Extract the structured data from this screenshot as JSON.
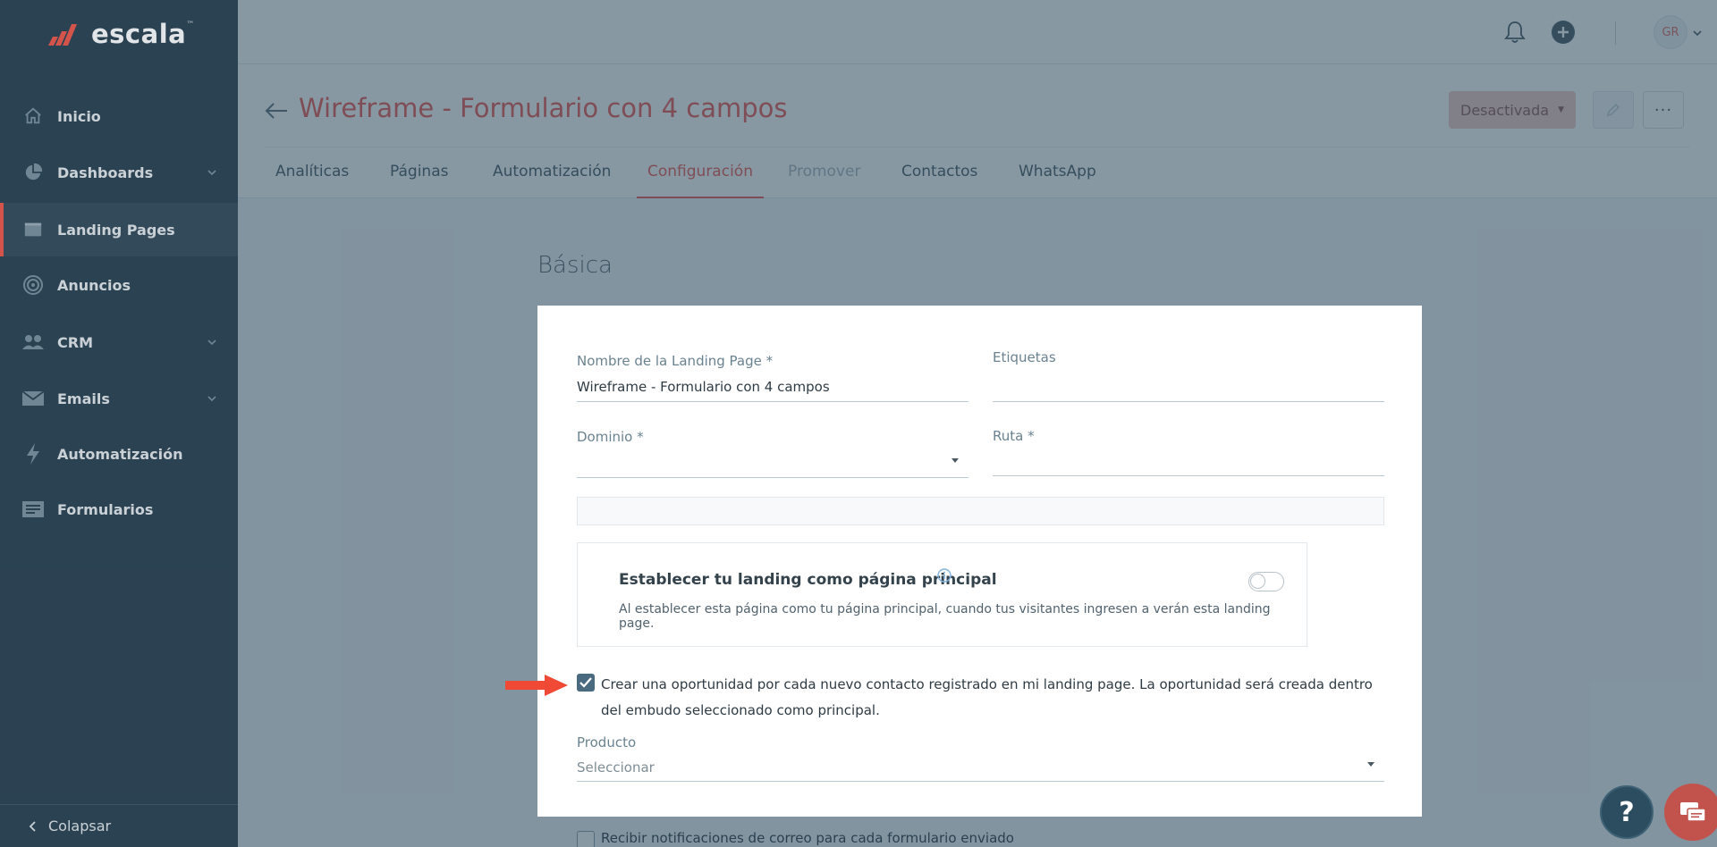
{
  "app": {
    "brand": "escala",
    "trademark": "™"
  },
  "sidebar": {
    "items": [
      {
        "label": "Inicio",
        "icon": "home-icon"
      },
      {
        "label": "Dashboards",
        "icon": "pie-chart-icon"
      },
      {
        "label": "Landing Pages",
        "icon": "browser-window-icon"
      },
      {
        "label": "Anuncios",
        "icon": "target-icon"
      },
      {
        "label": "CRM",
        "icon": "people-icon"
      },
      {
        "label": "Emails",
        "icon": "envelope-icon"
      },
      {
        "label": "Automatización",
        "icon": "lightning-icon"
      },
      {
        "label": "Formularios",
        "icon": "form-icon"
      }
    ],
    "collapse_label": "Colapsar"
  },
  "topbar": {
    "avatar_initials": "GR"
  },
  "header": {
    "title": "Wireframe - Formulario con 4 campos",
    "status_label": "Desactivada",
    "more_label": "···",
    "tabs": [
      {
        "label": "Analíticas"
      },
      {
        "label": "Páginas"
      },
      {
        "label": "Automatización"
      },
      {
        "label": "Configuración"
      },
      {
        "label": "Promover"
      },
      {
        "label": "Contactos"
      },
      {
        "label": "WhatsApp"
      }
    ]
  },
  "main": {
    "section_title": "Básica",
    "fields": {
      "name_label": "Nombre de la Landing Page *",
      "name_value": "Wireframe - Formulario con 4 campos",
      "tags_label": "Etiquetas",
      "domain_label": "Dominio *",
      "route_label": "Ruta *",
      "product_label": "Producto",
      "product_placeholder": "Seleccionar"
    },
    "homepage": {
      "title": "Establecer tu landing como página principal",
      "description": "Al establecer esta página como tu página principal, cuando tus visitantes ingresen a verán esta landing page."
    },
    "opportunity_text": "Crear una oportunidad por cada nuevo contacto registrado en mi landing page. La oportunidad será creada dentro del embudo seleccionado como principal.",
    "notify_text": "Recibir notificaciones de correo para cada formulario enviado"
  },
  "help": {
    "label": "?"
  },
  "colors": {
    "accent": "#ee5a52",
    "sidebar": "#2f4656"
  }
}
